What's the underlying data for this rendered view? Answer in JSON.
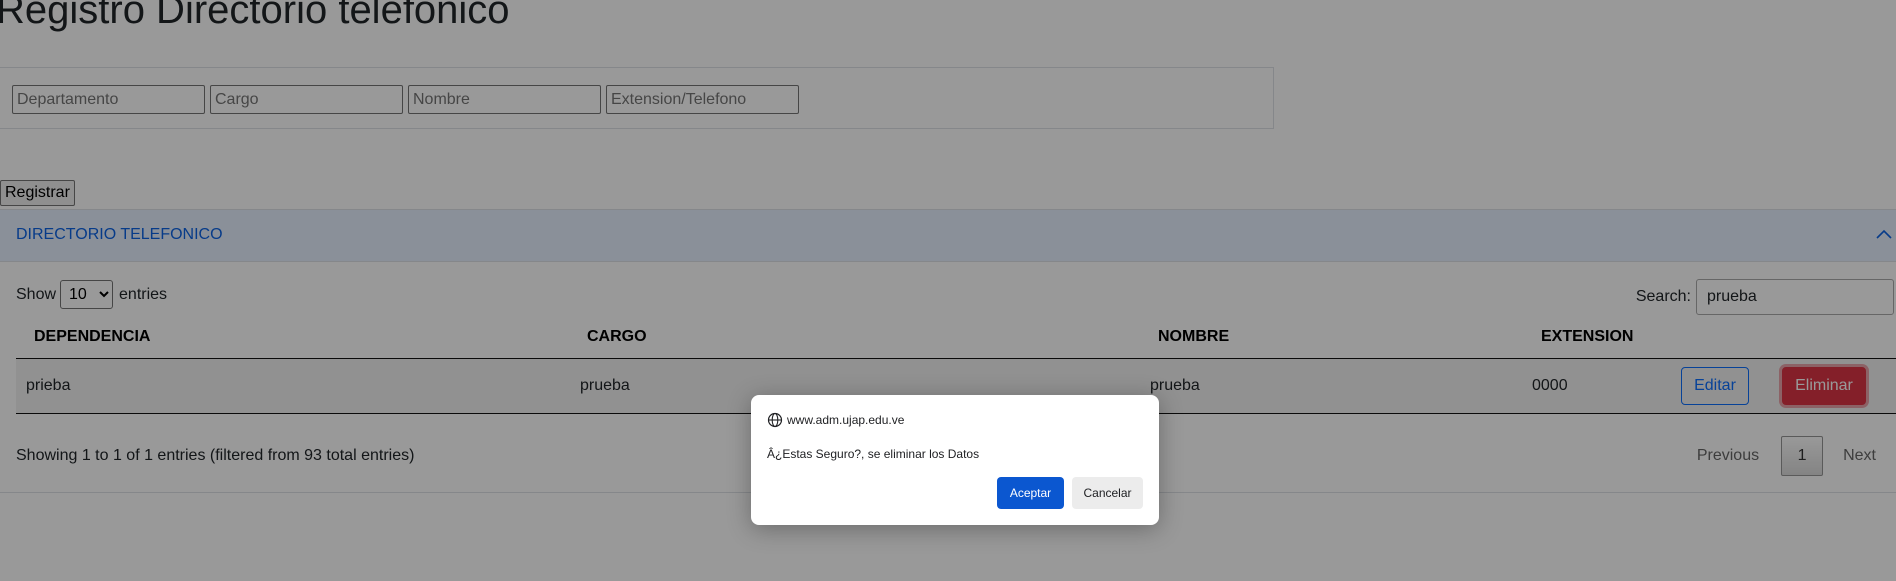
{
  "page": {
    "title": "Registro Directorio telefónico"
  },
  "form": {
    "departamento_placeholder": "Departamento",
    "cargo_placeholder": "Cargo",
    "nombre_placeholder": "Nombre",
    "extension_placeholder": "Extension/Telefono",
    "submit_label": "Registrar"
  },
  "accordion": {
    "title": "DIRECTORIO TELEFONICO",
    "icon": "chevron-up-icon",
    "expanded": true
  },
  "table_controls": {
    "show_label": "Show",
    "entries_label": "entries",
    "length_options": [
      "10"
    ],
    "length_selected": "10",
    "search_label": "Search:",
    "search_value": "prueba"
  },
  "table": {
    "headers": [
      "DEPENDENCIA",
      "CARGO",
      "NOMBRE",
      "EXTENSION"
    ],
    "rows": [
      {
        "dependencia": "prieba",
        "cargo": "prueba",
        "nombre": "prueba",
        "extension": "0000",
        "edit_label": "Editar",
        "delete_label": "Eliminar"
      }
    ]
  },
  "footer": {
    "info": "Showing 1 to 1 of 1 entries (filtered from 93 total entries)",
    "previous_label": "Previous",
    "current_page": "1",
    "next_label": "Next"
  },
  "dialog": {
    "origin": "www.adm.ujap.edu.ve",
    "origin_icon": "globe-icon",
    "message": "Â¿Estas Seguro?, se eliminar los Datos",
    "ok_label": "Aceptar",
    "cancel_label": "Cancelar"
  },
  "colors": {
    "primary": "#0d6efd",
    "danger": "#dc3545",
    "accordion_bg": "#e7f1ff",
    "dialog_ok": "#0b57d0"
  }
}
